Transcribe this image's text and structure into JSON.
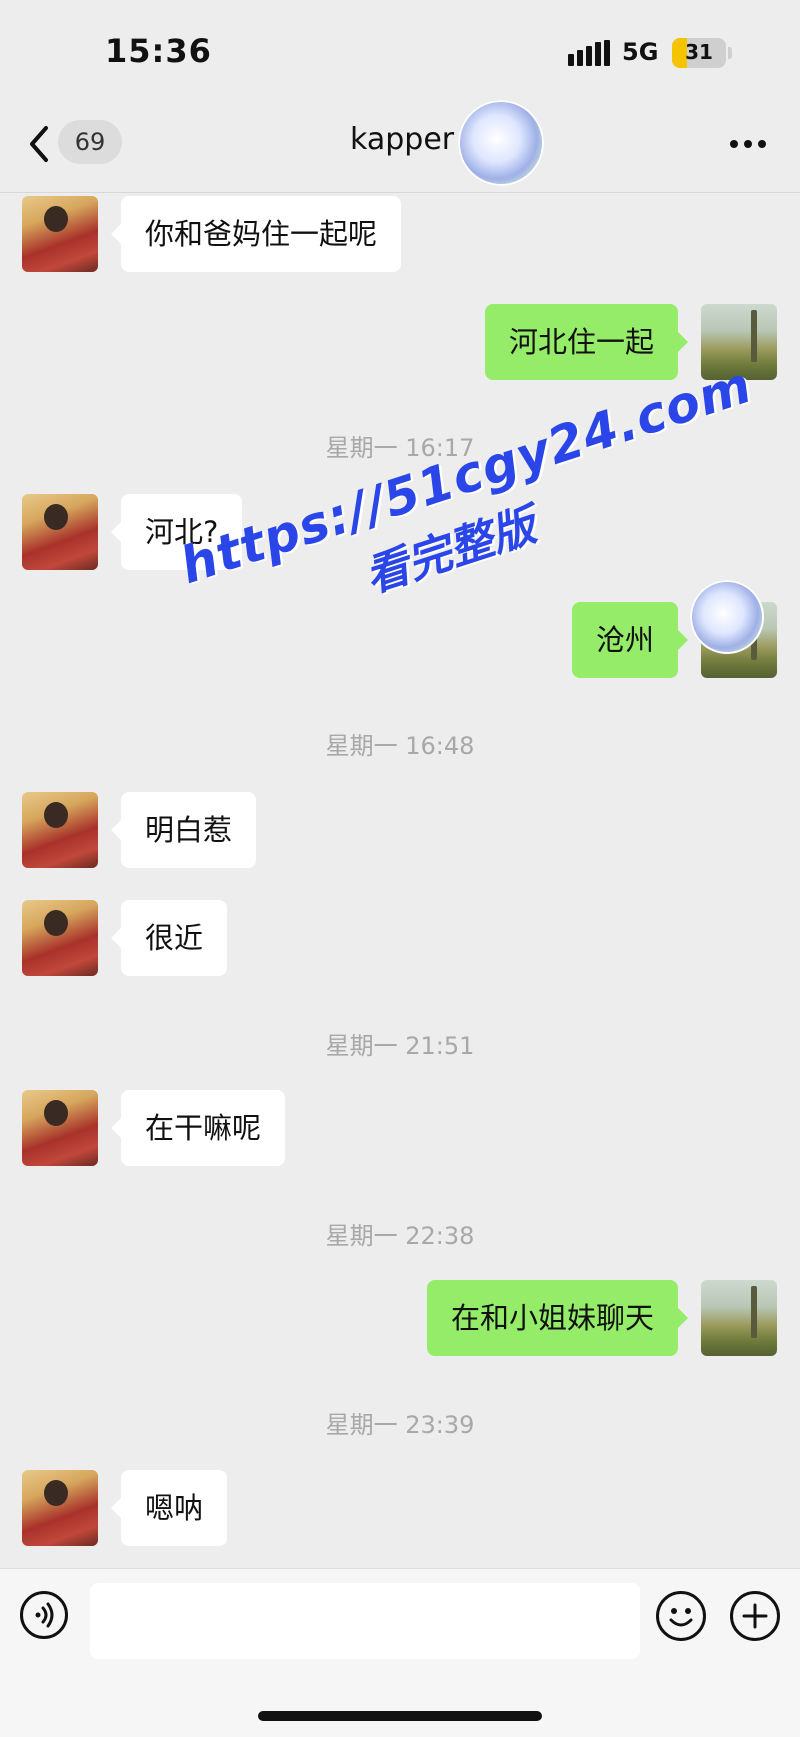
{
  "status_bar": {
    "time": "15:36",
    "network": "5G",
    "battery": "31",
    "battery_level_percent": 31
  },
  "nav": {
    "unread_count": "69",
    "contact_name": "kapper",
    "icons": [
      "back-chevron-icon",
      "more-icon"
    ]
  },
  "messages": [
    {
      "type": "in",
      "text": "你和爸妈住一起呢"
    },
    {
      "type": "out",
      "text": "河北住一起"
    },
    {
      "type": "timestamp",
      "text": "星期一 16:17"
    },
    {
      "type": "in",
      "text": "河北?"
    },
    {
      "type": "out",
      "text": "沧州"
    },
    {
      "type": "timestamp",
      "text": "星期一 16:48"
    },
    {
      "type": "in",
      "text": "明白惹"
    },
    {
      "type": "in",
      "text": "很近"
    },
    {
      "type": "timestamp",
      "text": "星期一 21:51"
    },
    {
      "type": "in",
      "text": "在干嘛呢"
    },
    {
      "type": "timestamp",
      "text": "星期一 22:38"
    },
    {
      "type": "out",
      "text": "在和小姐妹聊天"
    },
    {
      "type": "timestamp",
      "text": "星期一 23:39"
    },
    {
      "type": "in",
      "text": "嗯呐"
    }
  ],
  "watermark": {
    "line1": "https://51cgy24.com",
    "line2": "看完整版"
  },
  "input_bar": {
    "icons": [
      "voice-icon",
      "emoji-icon",
      "plus-icon"
    ],
    "placeholder": ""
  },
  "colors": {
    "background": "#ededed",
    "incoming_bubble": "#ffffff",
    "outgoing_bubble": "#95ec69",
    "timestamp": "#a8a8a8",
    "watermark": "#2a46e8"
  }
}
